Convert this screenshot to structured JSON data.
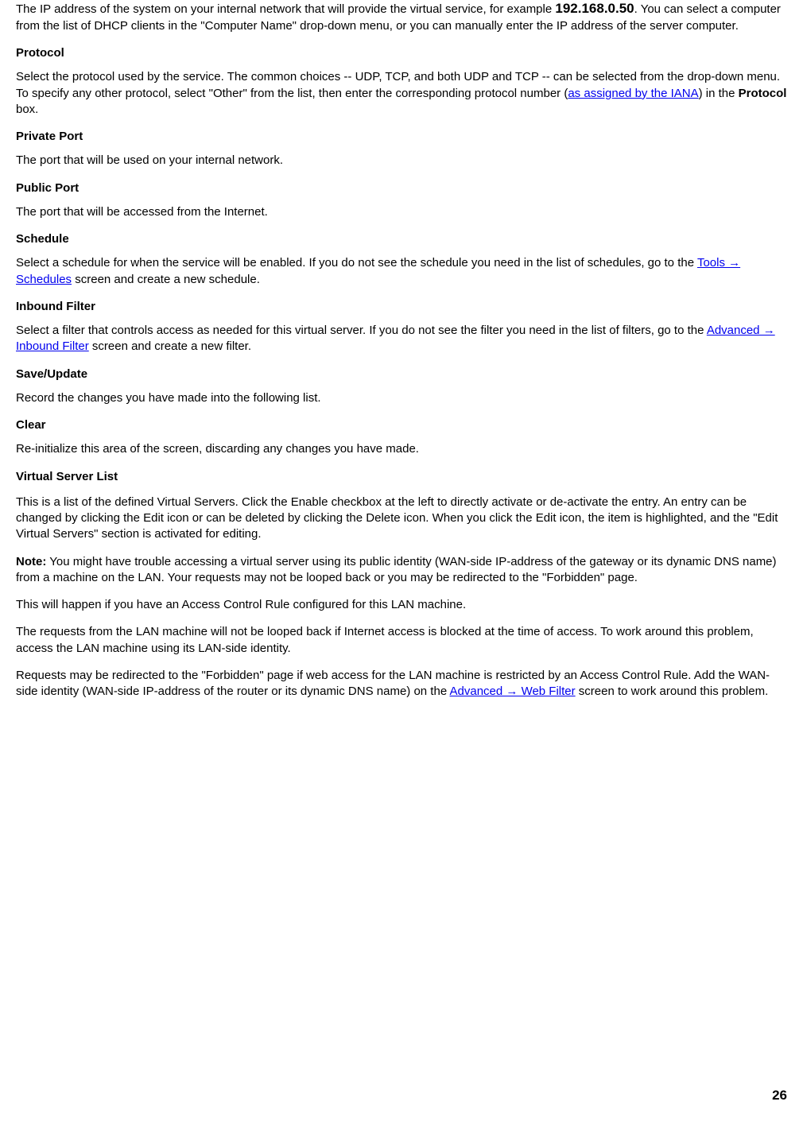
{
  "ipAddress": {
    "desc_a": "The IP address of the system on your internal network that will provide the virtual service, for example ",
    "ip": "192.168.0.50",
    "desc_b": ". You can select a computer from the list of DHCP clients in the \"Computer Name\" drop-down menu, or you can manually enter the IP address of the server computer."
  },
  "protocol": {
    "term": "Protocol",
    "desc_a": "Select the protocol used by the service. The common choices -- UDP, TCP, and both UDP and TCP -- can be selected from the drop-down menu. To specify any other protocol, select \"Other\" from the list, then enter the corresponding protocol number (",
    "link": "as assigned by the IANA",
    "desc_b": ") in the ",
    "bold": "Protocol",
    "desc_c": " box."
  },
  "privatePort": {
    "term": "Private Port",
    "desc": "The port that will be used on your internal network."
  },
  "publicPort": {
    "term": "Public Port",
    "desc": "The port that will be accessed from the Internet."
  },
  "schedule": {
    "term": "Schedule",
    "desc_a": "Select a schedule for when the service will be enabled. If you do not see the schedule you need in the list of schedules, go to the ",
    "link": "Tools → Schedules",
    "desc_b": " screen and create a new schedule."
  },
  "inboundFilter": {
    "term": "Inbound Filter",
    "desc_a": "Select a filter that controls access as needed for this virtual server. If you do not see the filter you need in the list of filters, go to the ",
    "link": "Advanced → Inbound Filter",
    "desc_b": " screen and create a new filter."
  },
  "saveUpdate": {
    "term": "Save/Update",
    "desc": "Record the changes you have made into the following list."
  },
  "clear": {
    "term": "Clear",
    "desc": "Re-initialize this area of the screen, discarding any changes you have made."
  },
  "vsList": {
    "header": "Virtual Server List",
    "desc": "This is a list of the defined Virtual Servers. Click the Enable checkbox at the left to directly activate or de-activate the entry. An entry can be changed by clicking the Edit icon or can be deleted by clicking the Delete icon. When you click the Edit icon, the item is highlighted, and the \"Edit Virtual Servers\" section is activated for editing."
  },
  "note": {
    "label": "Note:",
    "p1": " You might have trouble accessing a virtual server using its public identity (WAN-side IP-address of the gateway or its dynamic DNS name) from a machine on the LAN. Your requests may not be looped back or you may be redirected to the \"Forbidden\" page.",
    "p2": "This will happen if you have an Access Control Rule configured for this LAN machine.",
    "p3": "The requests from the LAN machine will not be looped back if Internet access is blocked at the time of access. To work around this problem, access the LAN machine using its LAN-side identity.",
    "p4_a": "Requests may be redirected to the \"Forbidden\" page if web access for the LAN machine is restricted by an Access Control Rule. Add the WAN-side identity (WAN-side IP-address of the router or its dynamic DNS name) on the ",
    "p4_link": "Advanced → Web Filter",
    "p4_b": " screen to work around this problem."
  },
  "pageNumber": "26"
}
